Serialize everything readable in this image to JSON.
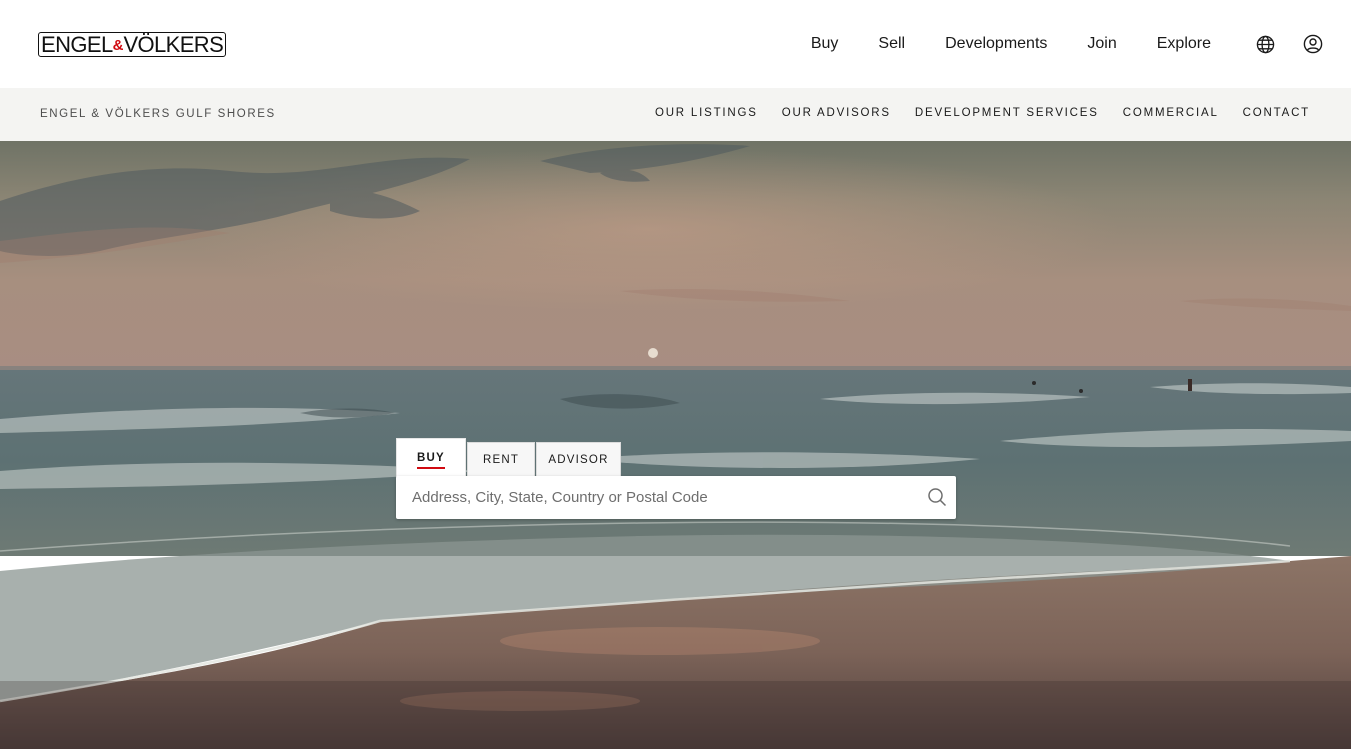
{
  "brand": {
    "logo_text_left": "ENGEL",
    "logo_ampersand": "&",
    "logo_text_right": "VÖLKERS",
    "accent_color": "#d10a11"
  },
  "main_nav": {
    "items": [
      "Buy",
      "Sell",
      "Developments",
      "Join",
      "Explore"
    ],
    "icons": [
      "globe-icon",
      "user-account-icon"
    ]
  },
  "sub_header": {
    "shop_name": "ENGEL & VÖLKERS GULF SHORES",
    "items": [
      "OUR LISTINGS",
      "OUR ADVISORS",
      "DEVELOPMENT SERVICES",
      "COMMERCIAL",
      "CONTACT"
    ]
  },
  "search": {
    "tabs": [
      "BUY",
      "RENT",
      "ADVISOR"
    ],
    "active_tab": "BUY",
    "placeholder": "Address, City, State, Country or Postal Code",
    "value": "",
    "icon": "search-icon"
  },
  "hero": {
    "image": "sunset-beach-waves"
  }
}
